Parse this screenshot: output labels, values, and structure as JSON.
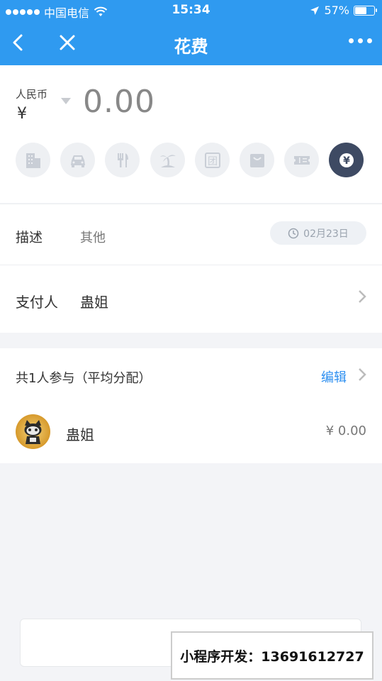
{
  "status_bar": {
    "carrier": "中国电信",
    "time": "15:34",
    "battery": "57%",
    "battery_level": 0.57
  },
  "nav": {
    "title": "花费"
  },
  "amount": {
    "currency_name": "人民币",
    "currency_symbol": "¥",
    "value": "0.00"
  },
  "categories": [
    {
      "icon": "building-icon",
      "active": false
    },
    {
      "icon": "car-icon",
      "active": false
    },
    {
      "icon": "fork-knife-icon",
      "active": false
    },
    {
      "icon": "beach-icon",
      "active": false
    },
    {
      "icon": "group-buy-icon",
      "active": false
    },
    {
      "icon": "shopping-bag-icon",
      "active": false
    },
    {
      "icon": "ticket-icon",
      "active": false
    },
    {
      "icon": "yuan-icon",
      "active": true
    }
  ],
  "category_text": {
    "group_buy_char": "团",
    "yuan_char": "¥"
  },
  "description": {
    "label": "描述",
    "value": "其他",
    "date": "02月23日"
  },
  "payer": {
    "label": "支付人",
    "value": "蛊姐"
  },
  "participants": {
    "header": "共1人参与（平均分配）",
    "edit_label": "编辑",
    "members": [
      {
        "name": "蛊姐",
        "amount": "¥ 0.00"
      }
    ]
  },
  "watermark": {
    "text": "小程序开发：13691612727"
  },
  "colors": {
    "header_bg": "#2f9af0",
    "active_category": "#3e4a63",
    "link": "#2d8ff0"
  }
}
